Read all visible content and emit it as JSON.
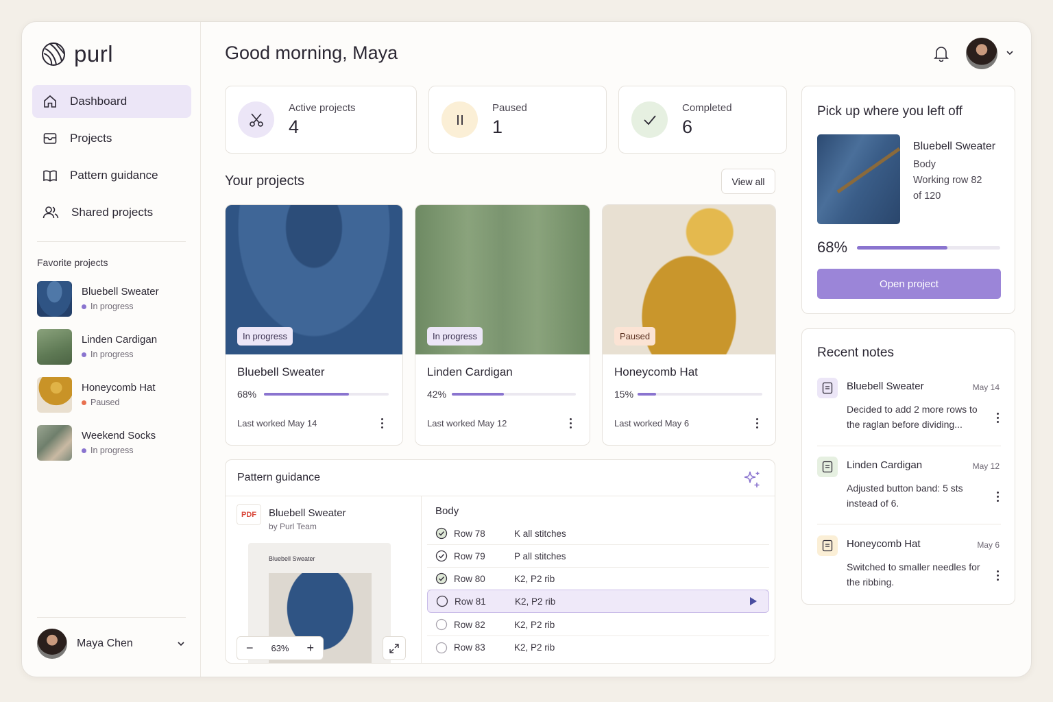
{
  "app": {
    "name": "purl"
  },
  "header": {
    "greeting": "Good morning, Maya"
  },
  "sidebar": {
    "nav": [
      {
        "label": "Dashboard",
        "icon": "home-icon",
        "active": true
      },
      {
        "label": "Projects",
        "icon": "inbox-icon"
      },
      {
        "label": "Pattern guidance",
        "icon": "book-icon"
      },
      {
        "label": "Shared projects",
        "icon": "users-icon"
      }
    ],
    "favorites_title": "Favorite projects",
    "favorites": [
      {
        "name": "Bluebell Sweater",
        "status": "In progress",
        "dot_color": "#8a74cf"
      },
      {
        "name": "Linden Cardigan",
        "status": "In progress",
        "dot_color": "#8a74cf"
      },
      {
        "name": "Honeycomb Hat",
        "status": "Paused",
        "dot_color": "#e8704f"
      },
      {
        "name": "Weekend Socks",
        "status": "In progress",
        "dot_color": "#8a74cf"
      }
    ],
    "user_name": "Maya Chen"
  },
  "stats": [
    {
      "label": "Active projects",
      "value": "4",
      "icon": "scissors-icon"
    },
    {
      "label": "Paused",
      "value": "1",
      "icon": "pause-icon"
    },
    {
      "label": "Completed",
      "value": "6",
      "icon": "check-icon"
    }
  ],
  "projects": {
    "title": "Your projects",
    "view_all": "View all",
    "items": [
      {
        "name": "Bluebell Sweater",
        "badge": "In progress",
        "percent": "68%",
        "progress": 0.68,
        "last_worked": "Last worked May 14"
      },
      {
        "name": "Linden Cardigan",
        "badge": "In progress",
        "percent": "42%",
        "progress": 0.42,
        "last_worked": "Last worked May 12"
      },
      {
        "name": "Honeycomb Hat",
        "badge": "Paused",
        "percent": "15%",
        "progress": 0.15,
        "last_worked": "Last worked May 6"
      }
    ]
  },
  "pattern": {
    "title": "Pattern guidance",
    "pdf_label": "PDF",
    "doc_title": "Bluebell Sweater",
    "doc_author": "by Purl Team",
    "preview_title": "Bluebell Sweater",
    "zoom": "63%",
    "section": "Body",
    "rows": [
      {
        "row": "Row 78",
        "instruction": "K all stitches",
        "done": true
      },
      {
        "row": "Row 79",
        "instruction": "P all stitches",
        "done": true
      },
      {
        "row": "Row 80",
        "instruction": "K2, P2 rib",
        "done": true
      },
      {
        "row": "Row 81",
        "instruction": "K2, P2 rib",
        "done": false,
        "current": true
      },
      {
        "row": "Row 82",
        "instruction": "K2, P2 rib",
        "done": false
      },
      {
        "row": "Row 83",
        "instruction": "K2, P2 rib",
        "done": false
      }
    ]
  },
  "pickup": {
    "title": "Pick up where you left off",
    "project": "Bluebell Sweater",
    "section": "Body",
    "working_line1": "Working row 82",
    "working_line2": "of 120",
    "percent": "68%",
    "progress": 0.68,
    "button": "Open project"
  },
  "notes": {
    "title": "Recent notes",
    "items": [
      {
        "project": "Bluebell Sweater",
        "date": "May 14",
        "text": "Decided to add 2 more rows to the raglan before dividing...",
        "color": "#ece6f7"
      },
      {
        "project": "Linden Cardigan",
        "date": "May 12",
        "text": "Adjusted button band: 5 sts instead of 6.",
        "color": "#e6f0e1"
      },
      {
        "project": "Honeycomb Hat",
        "date": "May 6",
        "text": "Switched to smaller needles for the ribbing.",
        "color": "#fbefd6"
      }
    ]
  }
}
